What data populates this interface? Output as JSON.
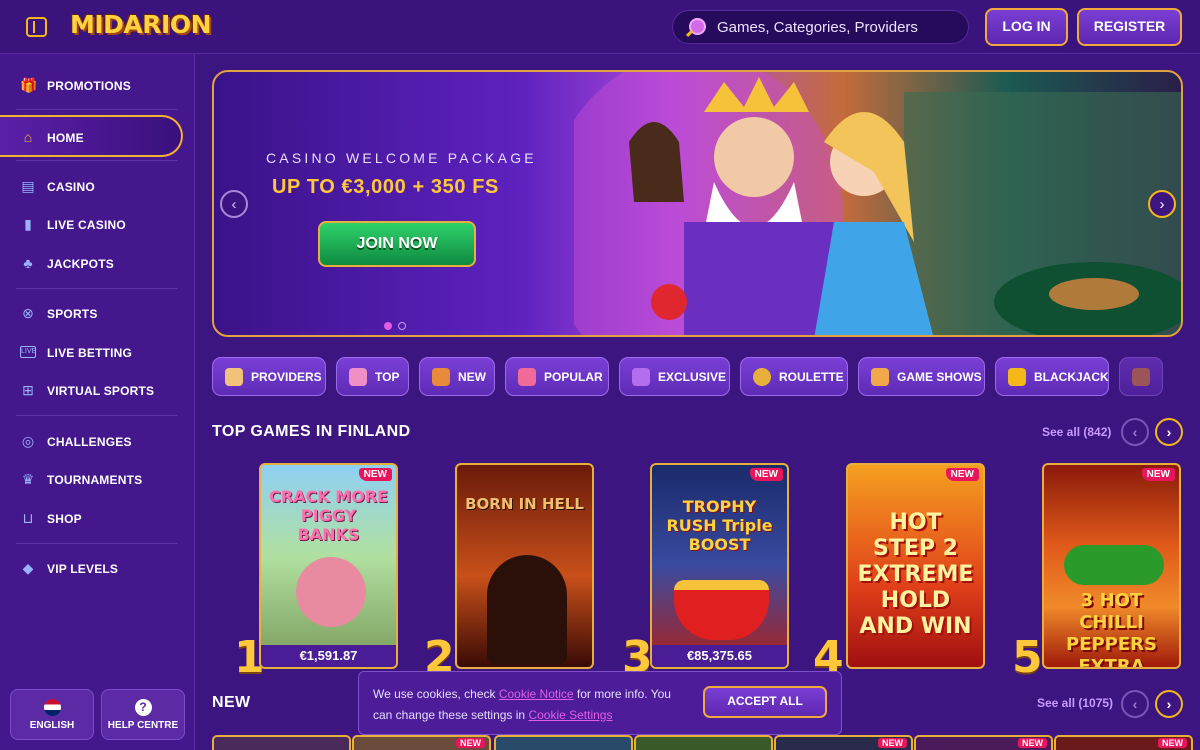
{
  "header": {
    "logo": "MIDARION",
    "search_placeholder": "Games, Categories, Providers",
    "login": "LOG IN",
    "register": "REGISTER"
  },
  "sidebar": {
    "items": [
      {
        "label": "PROMOTIONS",
        "icon": "gift-icon"
      },
      {
        "label": "HOME",
        "icon": "home-icon",
        "active": true
      },
      {
        "label": "CASINO",
        "icon": "slot-machine-icon"
      },
      {
        "label": "LIVE CASINO",
        "icon": "cards-icon"
      },
      {
        "label": "JACKPOTS",
        "icon": "clover-icon"
      },
      {
        "label": "SPORTS",
        "icon": "ball-icon"
      },
      {
        "label": "LIVE BETTING",
        "icon": "live-icon"
      },
      {
        "label": "VIRTUAL SPORTS",
        "icon": "gamepad-icon"
      },
      {
        "label": "CHALLENGES",
        "icon": "target-icon"
      },
      {
        "label": "TOURNAMENTS",
        "icon": "trophy-icon"
      },
      {
        "label": "SHOP",
        "icon": "basket-icon"
      },
      {
        "label": "VIP LEVELS",
        "icon": "diamond-icon"
      }
    ],
    "language": "ENGLISH",
    "help": "HELP CENTRE"
  },
  "hero": {
    "subtitle": "CASINO WELCOME PACKAGE",
    "title": "UP TO €3,000 + 350 FS",
    "cta": "JOIN NOW",
    "slides": 2,
    "active_slide": 1
  },
  "categories": [
    "PROVIDERS",
    "TOP",
    "NEW",
    "POPULAR",
    "EXCLUSIVE",
    "ROULETTE",
    "GAME SHOWS",
    "BLACKJACK"
  ],
  "top_games": {
    "title": "TOP GAMES IN FINLAND",
    "see_all": "See all (842)",
    "games": [
      {
        "rank": "1",
        "name": "CRACK MORE PIGGY BANKS",
        "price": "€1,591.87",
        "new": "NEW"
      },
      {
        "rank": "2",
        "name": "BORN IN HELL",
        "price": "",
        "new": ""
      },
      {
        "rank": "3",
        "name": "TROPHY RUSH Triple BOOST",
        "price": "€85,375.65",
        "new": "NEW"
      },
      {
        "rank": "4",
        "name": "HOT STEP 2 EXTREME HOLD AND WIN",
        "price": "",
        "new": "NEW"
      },
      {
        "rank": "5",
        "name": "3 HOT CHILLI PEPPERS EXTRA",
        "price": "",
        "new": "NEW"
      }
    ]
  },
  "new_games": {
    "title": "NEW",
    "see_all": "See all (1075)",
    "badge": "NEW"
  },
  "cookie": {
    "text_1": "We use cookies, check ",
    "link_1": "Cookie Notice",
    "text_2": " for more info. You can change these settings in ",
    "link_2": "Cookie Settings",
    "accept": "ACCEPT ALL"
  },
  "colors": {
    "accent_gold": "#f5b81b",
    "background": "#3d1580",
    "badge_new": "#e7165c",
    "cta_green": "#2fd16b"
  }
}
